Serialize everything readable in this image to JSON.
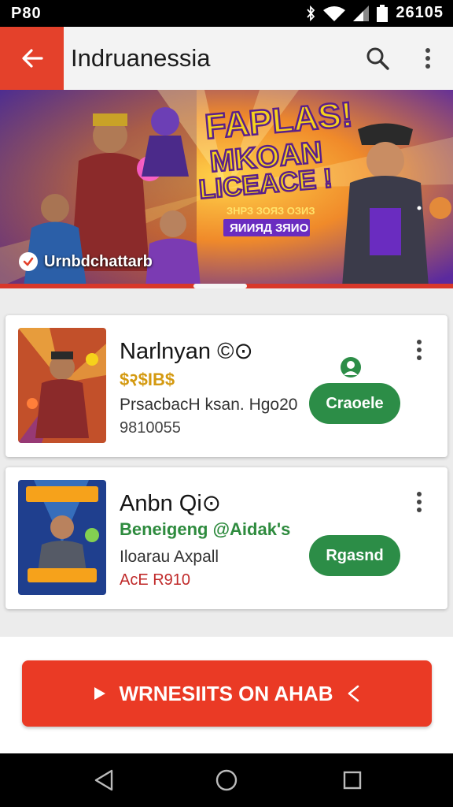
{
  "status_bar": {
    "time_left": "P80",
    "time_right": "26105"
  },
  "app_bar": {
    "title": "Indruanessia"
  },
  "banner": {
    "headline_1": "FAPLAS!",
    "headline_2": "MKOAN",
    "headline_3": "LICEACE !",
    "subline_1": "ЗНРЗ ЗОЯЗ ОЗИЗ",
    "subline_2": "ЯИИЯД ЗЯИО",
    "caption": "Urnbdchattarb",
    "colors": {
      "accent_yellow": "#f6d21b",
      "accent_purple": "#6a2cc0"
    }
  },
  "items": [
    {
      "name": "Narlnyan ©⊙",
      "price": "$२$IB$",
      "desc": "PrsacbacH ksan. Hgo20",
      "meta": "9810055",
      "action": "Craoele",
      "price_color": "#d49a11"
    },
    {
      "name": "Anbn Qi⊙",
      "price": "Beneigeng @Aidak's",
      "desc": "Iloarau Axpall",
      "meta": "AcE R910",
      "action": "Rgasnd",
      "price_color": "#2e8b3e"
    }
  ],
  "cta": {
    "label": "WRNESIITS ON AHAB"
  },
  "colors": {
    "brand_red": "#e4412b",
    "action_green": "#2c8d47"
  }
}
